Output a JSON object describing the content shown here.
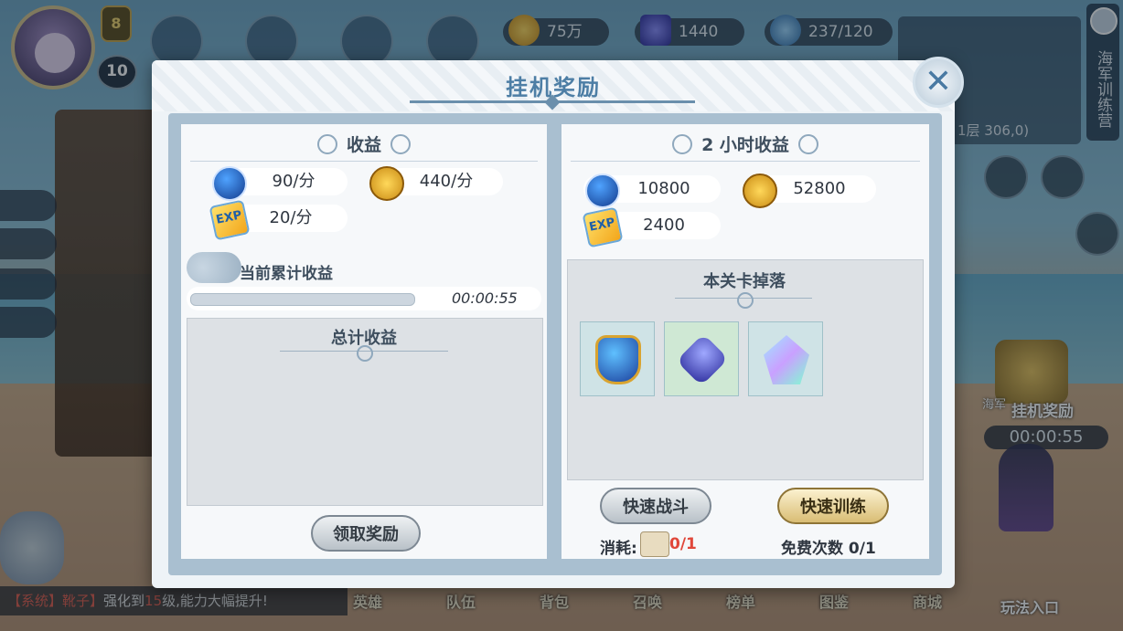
{
  "hud": {
    "player_level": "10",
    "rank_badge": "8",
    "gold": "75万",
    "gems": "1440",
    "stamina": "237/120",
    "floor_info": "1层  306,0)",
    "side_label": "海军训练营"
  },
  "idle_badge": {
    "label": "挂机奖励",
    "navy_label": "海军",
    "timer": "00:00:55"
  },
  "chat": {
    "tag": "【系统】",
    "name": "靴子】",
    "msg_a": "强化到",
    "level": "15",
    "msg_b": "级,能力大幅提升!"
  },
  "bottom_nav": [
    "英雄",
    "队伍",
    "背包",
    "召唤",
    "榜单",
    "图鉴",
    "商城"
  ],
  "play_entry": "玩法入口",
  "modal": {
    "title": "挂机奖励",
    "left": {
      "header": "收益",
      "rates": {
        "blue_exp": "90/分",
        "gold": "440/分",
        "exp": "20/分"
      },
      "accum_label": "当前累计收益",
      "progress_fraction": 0.0,
      "accum_time": "00:00:55",
      "total_title": "总计收益",
      "claim_button": "领取奖励"
    },
    "right": {
      "header": "2 小时收益",
      "amounts": {
        "blue_exp": "10800",
        "gold": "52800",
        "exp": "2400"
      },
      "drops_title": "本关卡掉落",
      "drops": [
        {
          "icon": "blue-feather-gem-icon",
          "bg": "blue"
        },
        {
          "icon": "purple-crystal-icon",
          "bg": "green"
        },
        {
          "icon": "star-crystal-icon",
          "bg": "blue"
        }
      ],
      "quick_battle": "快速战斗",
      "quick_train": "快速训练",
      "cost_label": "消耗:",
      "cost_value": "0/1",
      "free_label": "免费次数 0/1"
    }
  },
  "colors": {
    "title_blue": "#4d7ea5",
    "cost_red": "#e0473a",
    "gold_button": "#d9bd74"
  }
}
